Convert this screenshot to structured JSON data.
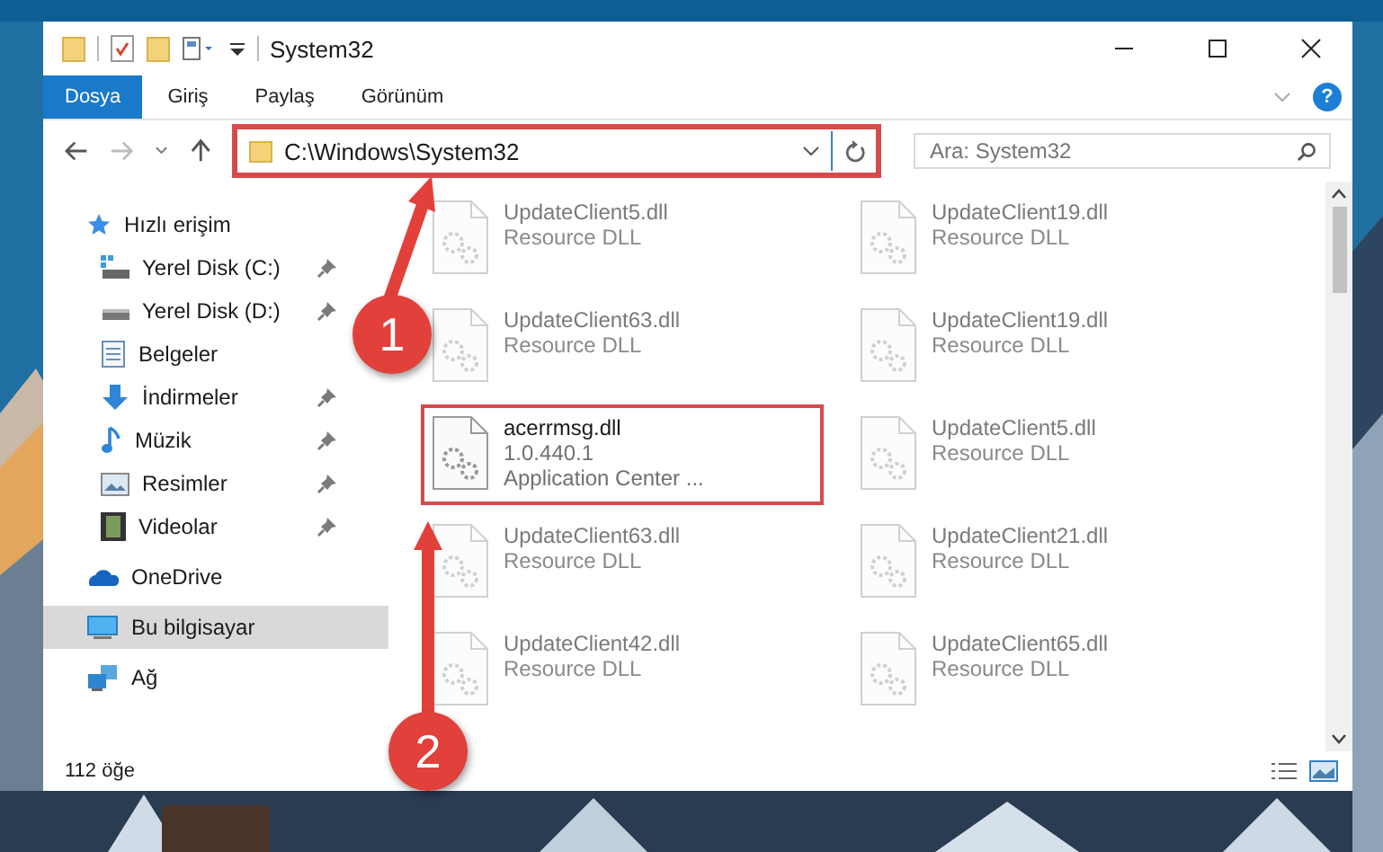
{
  "window": {
    "title": "System32"
  },
  "ribbon": {
    "tabs": [
      {
        "label": "Dosya",
        "selected": true
      },
      {
        "label": "Giriş",
        "selected": false
      },
      {
        "label": "Paylaş",
        "selected": false
      },
      {
        "label": "Görünüm",
        "selected": false
      }
    ],
    "help": "?"
  },
  "address": {
    "path": "C:\\Windows\\System32",
    "highlighted": true
  },
  "search": {
    "placeholder": "Ara: System32"
  },
  "sidebar": {
    "items": [
      {
        "label": "Hızlı erişim",
        "kind": "star",
        "selected": false,
        "children": [
          {
            "label": "Yerel Disk (C:)",
            "kind": "system-drive",
            "selected": false,
            "pinned": true
          },
          {
            "label": "Yerel Disk (D:)",
            "kind": "drive",
            "selected": false,
            "pinned": true
          },
          {
            "label": "Belgeler",
            "kind": "document",
            "selected": false,
            "pinned": false
          },
          {
            "label": "İndirmeler",
            "kind": "download",
            "selected": false,
            "pinned": true
          },
          {
            "label": "Müzik",
            "kind": "music",
            "selected": false,
            "pinned": true
          },
          {
            "label": "Resimler",
            "kind": "pictures",
            "selected": false,
            "pinned": true
          },
          {
            "label": "Videolar",
            "kind": "video",
            "selected": false,
            "pinned": true
          }
        ]
      },
      {
        "label": "OneDrive",
        "kind": "cloud",
        "selected": false
      },
      {
        "label": "Bu bilgisayar",
        "kind": "computer",
        "selected": true
      },
      {
        "label": "Ağ",
        "kind": "network",
        "selected": false
      }
    ]
  },
  "files": [
    {
      "name": "UpdateClient5.dll",
      "lines": [
        "Resource DLL"
      ],
      "blurred": true,
      "highlighted": false
    },
    {
      "name": "UpdateClient19.dll",
      "lines": [
        "Resource DLL"
      ],
      "blurred": true,
      "highlighted": false
    },
    {
      "name": "UpdateClient63.dll",
      "lines": [
        "Resource DLL"
      ],
      "blurred": true,
      "highlighted": false
    },
    {
      "name": "UpdateClient19.dll",
      "lines": [
        "Resource DLL"
      ],
      "blurred": true,
      "highlighted": false
    },
    {
      "name": "acerrmsg.dll",
      "lines": [
        "1.0.440.1",
        "Application Center ..."
      ],
      "blurred": false,
      "highlighted": true
    },
    {
      "name": "UpdateClient5.dll",
      "lines": [
        "Resource DLL"
      ],
      "blurred": true,
      "highlighted": false
    },
    {
      "name": "UpdateClient63.dll",
      "lines": [
        "Resource DLL"
      ],
      "blurred": true,
      "highlighted": false
    },
    {
      "name": "UpdateClient21.dll",
      "lines": [
        "Resource DLL"
      ],
      "blurred": true,
      "highlighted": false
    },
    {
      "name": "UpdateClient42.dll",
      "lines": [
        "Resource DLL"
      ],
      "blurred": true,
      "highlighted": false
    },
    {
      "name": "UpdateClient65.dll",
      "lines": [
        "Resource DLL"
      ],
      "blurred": true,
      "highlighted": false
    }
  ],
  "status_bar": {
    "count": "112 öğe"
  },
  "annotations": [
    {
      "number": "1"
    },
    {
      "number": "2"
    }
  ]
}
